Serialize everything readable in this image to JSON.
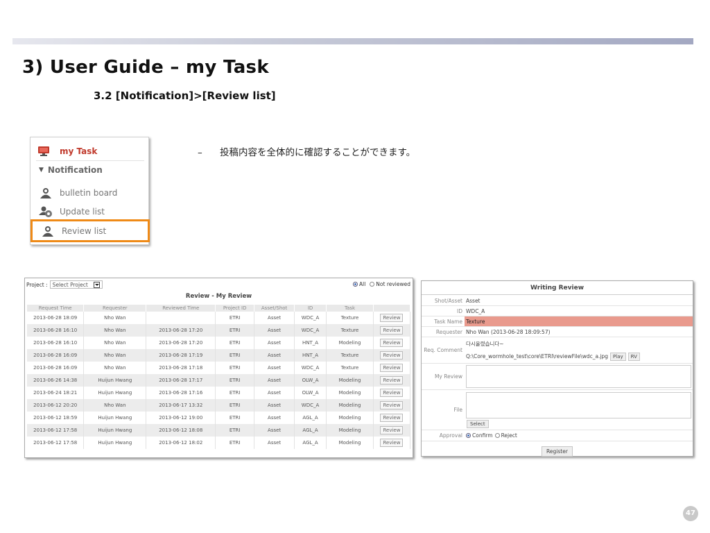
{
  "header": {
    "title": "3) User Guide – my Task",
    "subtitle": "3.2 [Notification]>[Review list]"
  },
  "menu": {
    "heading": "my Task",
    "section": "Notification",
    "items": [
      {
        "label": "bulletin board",
        "icon": "user-icon"
      },
      {
        "label": "Update list",
        "icon": "group-gear-icon"
      },
      {
        "label": "Review list",
        "icon": "user-icon",
        "selected": true
      }
    ],
    "highlight_color": "#ef8a17",
    "heading_color": "#c0392b"
  },
  "description": {
    "bullet": "–",
    "text": "投稿内容を全体的に確認することができます。"
  },
  "review_list": {
    "project_label": "Project :",
    "project_select": "Select Project",
    "filter_all": "All",
    "filter_not_reviewed": "Not reviewed",
    "title": "Review - My Review",
    "columns": [
      "Request Time",
      "Requester",
      "Reviewed Time",
      "Project ID",
      "Asset/Shot",
      "ID",
      "Task",
      ""
    ],
    "button_label": "Review",
    "rows": [
      [
        "2013-06-28 18:09",
        "Nho Wan",
        "",
        "ETRI",
        "Asset",
        "WDC_A",
        "Texture"
      ],
      [
        "2013-06-28 16:10",
        "Nho Wan",
        "2013-06-28 17:20",
        "ETRI",
        "Asset",
        "WDC_A",
        "Texture"
      ],
      [
        "2013-06-28 16:10",
        "Nho Wan",
        "2013-06-28 17:20",
        "ETRI",
        "Asset",
        "HNT_A",
        "Modeling"
      ],
      [
        "2013-06-28 16:09",
        "Nho Wan",
        "2013-06-28 17:19",
        "ETRI",
        "Asset",
        "HNT_A",
        "Texture"
      ],
      [
        "2013-06-28 16:09",
        "Nho Wan",
        "2013-06-28 17:18",
        "ETRI",
        "Asset",
        "WDC_A",
        "Texture"
      ],
      [
        "2013-06-26 14:38",
        "Huijun Hwang",
        "2013-06-28 17:17",
        "ETRI",
        "Asset",
        "OLW_A",
        "Modeling"
      ],
      [
        "2013-06-24 18:21",
        "Huijun Hwang",
        "2013-06-28 17:16",
        "ETRI",
        "Asset",
        "OLW_A",
        "Modeling"
      ],
      [
        "2013-06-12 20:20",
        "Nho Wan",
        "2013-06-17 13:32",
        "ETRI",
        "Asset",
        "WDC_A",
        "Modeling"
      ],
      [
        "2013-06-12 18:59",
        "Huijun Hwang",
        "2013-06-12 19:00",
        "ETRI",
        "Asset",
        "AGL_A",
        "Modeling"
      ],
      [
        "2013-06-12 17:58",
        "Huijun Hwang",
        "2013-06-12 18:08",
        "ETRI",
        "Asset",
        "AGL_A",
        "Modeling"
      ],
      [
        "2013-06-12 17:58",
        "Huijun Hwang",
        "2013-06-12 18:02",
        "ETRI",
        "Asset",
        "AGL_A",
        "Modeling"
      ]
    ]
  },
  "writing_review": {
    "title": "Writing Review",
    "shot_asset_label": "Shot/Asset",
    "shot_asset_value": "Asset",
    "id_label": "ID",
    "id_value": "WDC_A",
    "task_label": "Task Name",
    "task_value": "Texture",
    "task_highlight": "#e99a8d",
    "requester_label": "Requester",
    "requester_value": "Nho Wan (2013-06-28 18:09:57)",
    "comment_label": "Req. Comment",
    "comment_text": "다시올렸습니다~",
    "comment_path": "Q:\\Core_wormhole_test\\core\\ETRI\\reviewFile\\wdc_a.jpg",
    "play_label": "Play",
    "rv_label": "RV",
    "my_review_label": "My Review",
    "file_label": "File",
    "select_label": "Select",
    "approval_label": "Approval",
    "confirm_label": "Confirm",
    "reject_label": "Reject",
    "register_label": "Register"
  },
  "page_number": "47"
}
